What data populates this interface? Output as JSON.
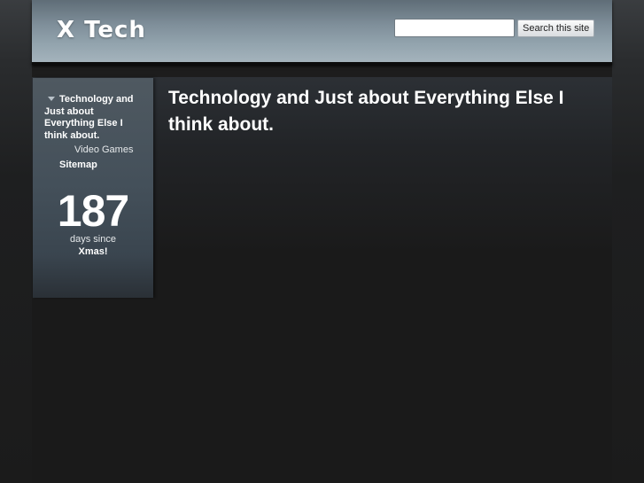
{
  "header": {
    "site_title": "X Tech",
    "search_placeholder": "",
    "search_value": "",
    "search_button_label": "Search this site"
  },
  "sidebar": {
    "nav": {
      "current_page": "Technology and Just about Everything Else I think about.",
      "sub_item": "Video Games",
      "sitemap": "Sitemap"
    },
    "countdown": {
      "number": "187",
      "label": "days since",
      "event": "Xmas!"
    }
  },
  "main": {
    "page_title": "Technology and Just about Everything Else I think about."
  }
}
